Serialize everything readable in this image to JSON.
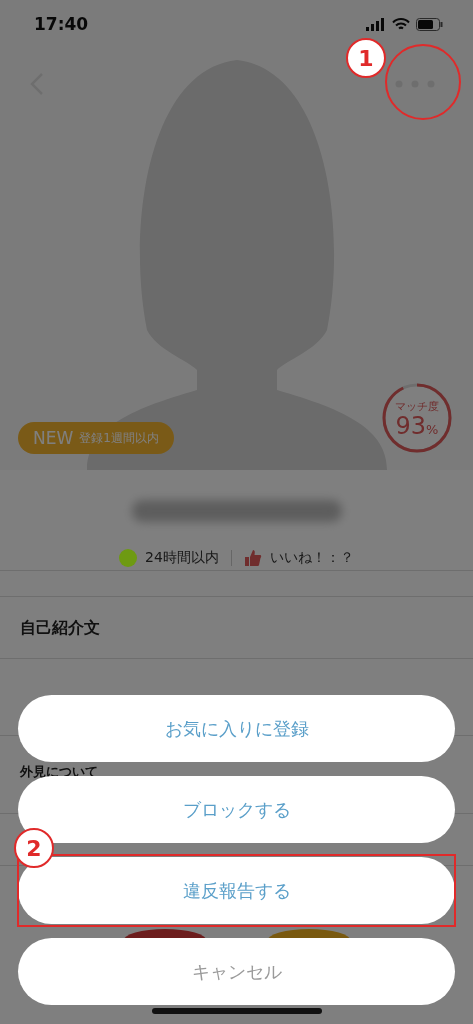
{
  "status_bar": {
    "time": "17:40"
  },
  "profile": {
    "new_badge": {
      "label": "NEW",
      "text": "登録1週間以内"
    },
    "match": {
      "label": "マッチ度",
      "value": "93",
      "unit": "%",
      "level": 0.93
    },
    "status": {
      "online": {
        "color": "#6e9a12",
        "text": "24時間以内"
      },
      "likes_text": "いいね！：？"
    },
    "sections": [
      {
        "title": "自己紹介文"
      },
      {
        "title": "外見について"
      }
    ]
  },
  "action_sheet": {
    "actions": [
      {
        "label": "お気に入りに登録",
        "kind": "action"
      },
      {
        "label": "ブロックする",
        "kind": "action"
      },
      {
        "label": "違反報告する",
        "kind": "action"
      },
      {
        "label": "キャンセル",
        "kind": "cancel"
      }
    ]
  },
  "annotations": [
    {
      "number": "1"
    },
    {
      "number": "2"
    }
  ]
}
